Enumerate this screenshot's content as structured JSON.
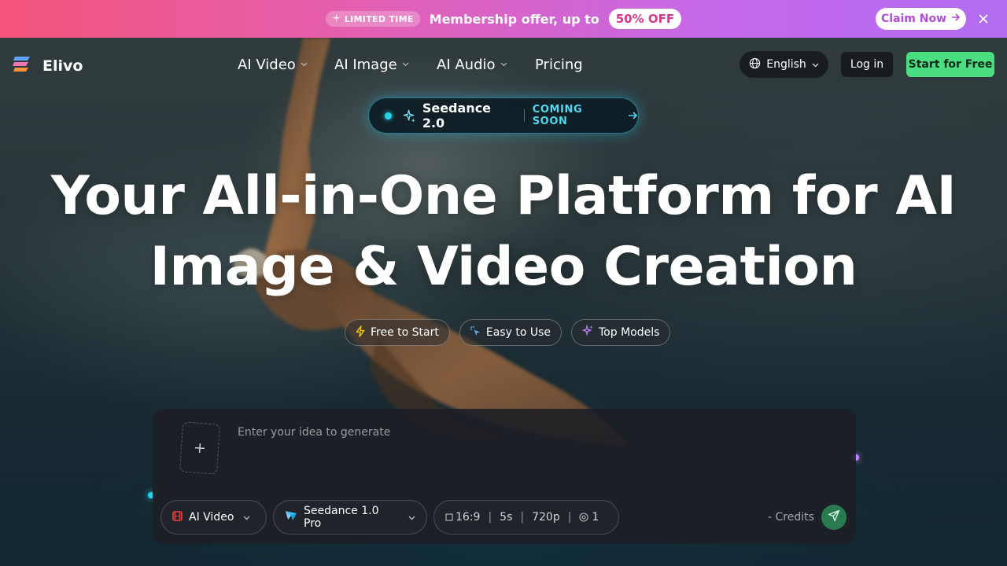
{
  "promo": {
    "tag": "LIMITED TIME",
    "text": "Membership offer, up to",
    "discount": "50% OFF",
    "cta": "Claim Now",
    "close_icon": "close-icon"
  },
  "brand": {
    "name": "Elivo"
  },
  "nav": {
    "items": [
      {
        "label": "AI Video",
        "has_dropdown": true
      },
      {
        "label": "AI Image",
        "has_dropdown": true
      },
      {
        "label": "AI Audio",
        "has_dropdown": true
      },
      {
        "label": "Pricing",
        "has_dropdown": false
      }
    ],
    "language": "English",
    "login": "Log in",
    "start": "Start for Free"
  },
  "announcement": {
    "title": "Seedance 2.0",
    "status": "COMING SOON"
  },
  "hero": {
    "headline_line1": "Your All-in-One Platform for AI",
    "headline_line2": "Image & Video Creation",
    "chips": [
      {
        "label": "Free to Start",
        "icon": "lightning-icon",
        "color": "#facc15"
      },
      {
        "label": "Easy to Use",
        "icon": "cursor-click-icon",
        "color": "#60a5fa"
      },
      {
        "label": "Top Models",
        "icon": "sparkles-icon",
        "color": "#c084fc"
      }
    ]
  },
  "prompt": {
    "placeholder": "Enter your idea to generate",
    "value": "",
    "mode": "AI Video",
    "model": "Seedance 1.0 Pro",
    "ratio": "16:9",
    "duration": "5s",
    "resolution": "720p",
    "count": "1",
    "credits": "- Credits"
  },
  "colors": {
    "accent_green": "#4ade80",
    "accent_cyan": "#22d3ee",
    "promo_pink": "#f2547a",
    "promo_purple": "#b16cf2"
  }
}
